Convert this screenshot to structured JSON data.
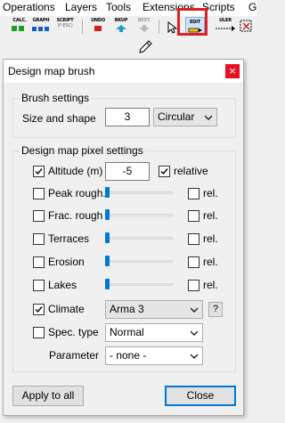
{
  "menu": [
    "Operations",
    "Layers",
    "Tools",
    "Extensions",
    "Scripts",
    "G"
  ],
  "toolbar": {
    "calc": "CALC.",
    "graph": "GRAPH",
    "script": "SCRIPT",
    "script_sub": "(F-ESC)",
    "undo": "UNDO",
    "bkup": "BKUP",
    "rest": "REST.",
    "edit": "EDIT",
    "ruler": "ULER"
  },
  "dialog": {
    "title": "Design map brush",
    "close_glyph": "×",
    "brush_settings": {
      "title": "Brush settings",
      "size_label": "Size and shape",
      "size_value": "3",
      "shape_value": "Circular"
    },
    "pixel_settings": {
      "title": "Design map pixel settings",
      "altitude": {
        "label": "Altitude (m)",
        "checked": true,
        "value": "-5",
        "relative_label": "relative",
        "relative_checked": true
      },
      "peak": {
        "label": "Peak rough.",
        "checked": false,
        "rel_label": "rel.",
        "rel_checked": false,
        "level": 0
      },
      "frac": {
        "label": "Frac. rough",
        "checked": false,
        "rel_label": "rel.",
        "rel_checked": false,
        "level": 0
      },
      "terraces": {
        "label": "Terraces",
        "checked": false,
        "rel_label": "rel.",
        "rel_checked": false,
        "level": 0
      },
      "erosion": {
        "label": "Erosion",
        "checked": false,
        "rel_label": "rel.",
        "rel_checked": false,
        "level": 0
      },
      "lakes": {
        "label": "Lakes",
        "checked": false,
        "rel_label": "rel.",
        "rel_checked": false,
        "level": 0
      },
      "climate": {
        "label": "Climate",
        "checked": true,
        "value": "Arma 3",
        "help": "?"
      },
      "spec_type": {
        "label": "Spec. type",
        "checked": false,
        "value": "Normal"
      },
      "parameter": {
        "label": "Parameter",
        "value": "- none -"
      }
    },
    "apply_all": "Apply to all",
    "close_button": "Close"
  },
  "colors": {
    "accent": "#0078d7",
    "highlight": "#e02020",
    "close_bg": "#e81123"
  }
}
